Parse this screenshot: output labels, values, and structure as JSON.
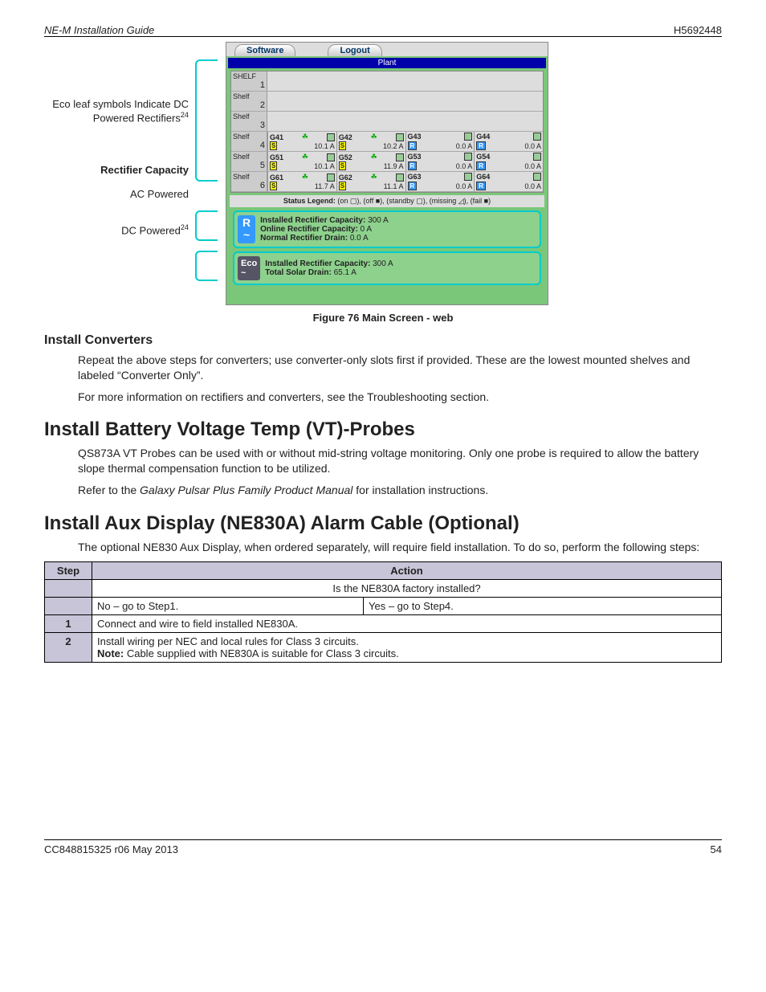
{
  "header": {
    "left": "NE-M Installation Guide",
    "right": "H5692448"
  },
  "callouts": {
    "eco": "Eco leaf symbols Indicate DC Powered Rectifiers",
    "eco_sup": "24",
    "capacity_head": "Rectifier Capacity",
    "ac": "AC Powered",
    "dc": "DC Powered",
    "dc_sup": "24"
  },
  "panel": {
    "tabs": [
      "Software",
      "Logout"
    ],
    "plant": "Plant",
    "shelf_label": "Shelf",
    "shelf_label_caps": "SHELF",
    "shelves_empty": [
      1,
      2,
      3
    ],
    "shelves": [
      {
        "n": 4,
        "mods": [
          {
            "id": "G41",
            "leaf": true,
            "amps": "10.1 A",
            "type": "S",
            "sq": "#9c9"
          },
          {
            "id": "G42",
            "leaf": true,
            "amps": "10.2 A",
            "type": "S",
            "sq": "#9c9"
          },
          {
            "id": "G43",
            "leaf": false,
            "amps": "0.0 A",
            "type": "R",
            "sq": "#9c9"
          },
          {
            "id": "G44",
            "leaf": false,
            "amps": "0.0 A",
            "type": "R",
            "sq": "#9c9"
          }
        ]
      },
      {
        "n": 5,
        "mods": [
          {
            "id": "G51",
            "leaf": true,
            "amps": "10.1 A",
            "type": "S",
            "sq": "#9c9"
          },
          {
            "id": "G52",
            "leaf": true,
            "amps": "11.9 A",
            "type": "S",
            "sq": "#9c9"
          },
          {
            "id": "G53",
            "leaf": false,
            "amps": "0.0 A",
            "type": "R",
            "sq": "#9c9"
          },
          {
            "id": "G54",
            "leaf": false,
            "amps": "0.0 A",
            "type": "R",
            "sq": "#9c9"
          }
        ]
      },
      {
        "n": 6,
        "mods": [
          {
            "id": "G61",
            "leaf": true,
            "amps": "11.7 A",
            "type": "S",
            "sq": "#9c9"
          },
          {
            "id": "G62",
            "leaf": true,
            "amps": "11.1 A",
            "type": "S",
            "sq": "#9c9"
          },
          {
            "id": "G63",
            "leaf": false,
            "amps": "0.0 A",
            "type": "R",
            "sq": "#9c9"
          },
          {
            "id": "G64",
            "leaf": false,
            "amps": "0.0 A",
            "type": "R",
            "sq": "#9c9"
          }
        ]
      }
    ],
    "legend_label": "Status Legend:",
    "legend_items": "(on ▢), (off ■), (standby ▢), (missing ◿), (fail ■)",
    "ac_box": {
      "line1_label": "Installed Rectifier Capacity:",
      "line1_val": "300 A",
      "line2_label": "Online Rectifier Capacity:",
      "line2_val": "0 A",
      "line3_label": "Normal Rectifier Drain:",
      "line3_val": "0.0 A"
    },
    "dc_box": {
      "line1_label": "Installed Rectifier Capacity:",
      "line1_val": "300 A",
      "line2_label": "Total Solar Drain:",
      "line2_val": "65.1 A"
    }
  },
  "figure_caption": "Figure 76 Main Screen - web",
  "sections": {
    "install_converters": {
      "title": "Install Converters",
      "p1": "Repeat the above steps for converters; use converter-only slots first if provided. These are the lowest mounted shelves and labeled “Converter Only”.",
      "p2": "For more information on rectifiers and converters, see the Troubleshooting section."
    },
    "vt_probes": {
      "title": "Install Battery Voltage Temp (VT)-Probes",
      "p1": "QS873A VT Probes can be used with or without mid-string voltage monitoring. Only one probe is required to allow the battery slope thermal compensation function to be utilized.",
      "p2_pre": "Refer to the ",
      "p2_em": "Galaxy Pulsar Plus Family Product Manual",
      "p2_post": " for installation instructions."
    },
    "aux_display": {
      "title": "Install Aux Display (NE830A) Alarm Cable (Optional)",
      "p1": "The optional NE830 Aux Display, when ordered separately, will require field installation. To do so, perform the following steps:"
    }
  },
  "table": {
    "head_step": "Step",
    "head_action": "Action",
    "q": "Is the NE830A factory installed?",
    "no": "No – go to Step1.",
    "yes": "Yes – go to Step4.",
    "s1": "1",
    "s1_txt": "Connect and wire to field installed NE830A.",
    "s2": "2",
    "s2_l1": "Install wiring per NEC and local rules for Class 3 circuits.",
    "s2_note_label": "Note:",
    "s2_l2": "  Cable supplied with NE830A is suitable for Class 3 circuits."
  },
  "footer": {
    "left": "CC848815325  r06   May 2013",
    "right": "54"
  }
}
